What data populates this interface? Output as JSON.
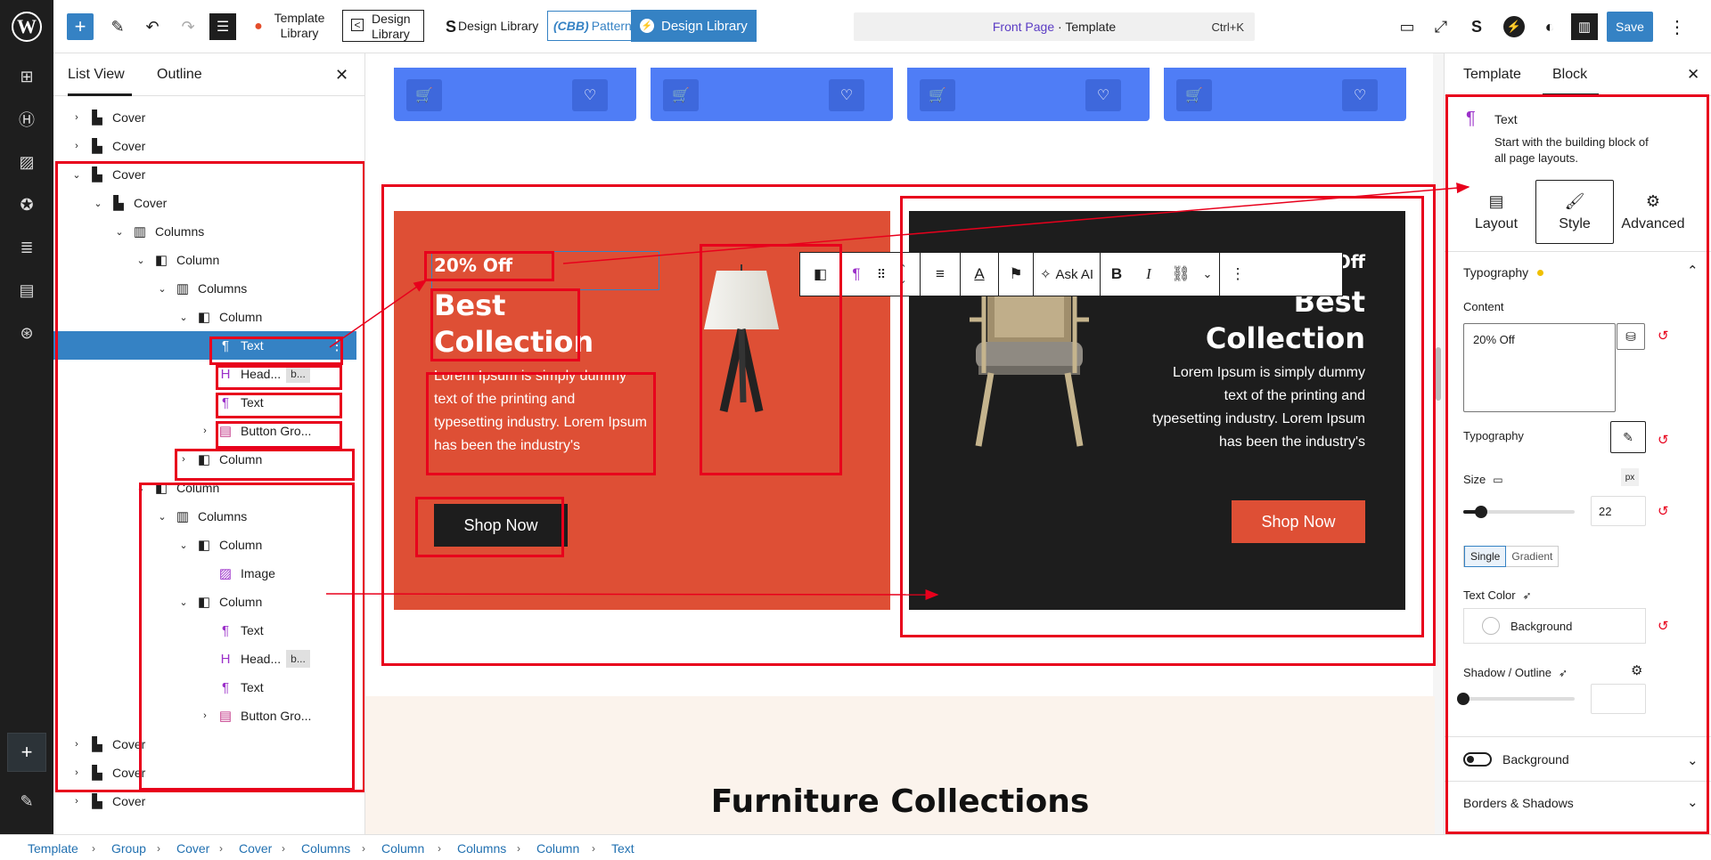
{
  "topbar": {
    "template_library": [
      "Template",
      "Library"
    ],
    "design_library_boxed": [
      "Design",
      "Library"
    ],
    "design_library": "Design Library",
    "cbb_pattern": "Pattern",
    "cbb_badge": "CBB",
    "design_library_btn": "Design Library",
    "command_title": "Front Page",
    "command_sep": " · ",
    "command_sub": "Template",
    "command_shortcut": "Ctrl+K",
    "save": "Save"
  },
  "listview": {
    "tabs": [
      "List View",
      "Outline"
    ],
    "rows": [
      {
        "label": "Cover"
      },
      {
        "label": "Cover"
      },
      {
        "label": "Cover"
      },
      {
        "label": "Cover"
      },
      {
        "label": "Columns"
      },
      {
        "label": "Column"
      },
      {
        "label": "Columns"
      },
      {
        "label": "Column"
      },
      {
        "label": "Text"
      },
      {
        "label": "Head...",
        "badge": "b..."
      },
      {
        "label": "Text"
      },
      {
        "label": "Button Gro..."
      },
      {
        "label": "Column"
      },
      {
        "label": "Column"
      },
      {
        "label": "Columns"
      },
      {
        "label": "Column"
      },
      {
        "label": "Image"
      },
      {
        "label": "Column"
      },
      {
        "label": "Text"
      },
      {
        "label": "Head...",
        "badge": "b..."
      },
      {
        "label": "Text"
      },
      {
        "label": "Button Gro..."
      },
      {
        "label": "Cover"
      },
      {
        "label": "Cover"
      },
      {
        "label": "Cover"
      }
    ]
  },
  "canvas": {
    "promo1": {
      "sub": "20% Off",
      "heading": [
        "Best",
        "Collection"
      ],
      "text": [
        "Lorem Ipsum is simply dummy",
        "text of the printing and",
        "typesetting industry. Lorem Ipsum",
        "has been the industry's"
      ],
      "button": "Shop Now"
    },
    "promo2": {
      "sub": "20% Off",
      "heading": [
        "Best",
        "Collection"
      ],
      "text": [
        "Lorem Ipsum is simply dummy",
        "text of the printing and",
        "typesetting industry. Lorem Ipsum",
        "has been the industry's"
      ],
      "button": "Shop Now"
    },
    "block_toolbar": {
      "ask_ai": "Ask AI"
    },
    "section_title": "Furniture Collections"
  },
  "rpanel": {
    "tabs": [
      "Template",
      "Block"
    ],
    "block_name": "Text",
    "block_desc": [
      "Start with the building block of",
      "all page layouts."
    ],
    "style_tabs": [
      "Layout",
      "Style",
      "Advanced"
    ],
    "typography_section": "Typography",
    "content_label": "Content",
    "content_value": "20% Off",
    "typography_label": "Typography",
    "size_label": "Size",
    "size_unit": "px",
    "size_value": "22",
    "size_level_percent": 16,
    "fill_tabs": [
      "Single",
      "Gradient"
    ],
    "text_color_label": "Text Color",
    "text_color_value": "Background",
    "shadow_label": "Shadow / Outline",
    "shadow_level_percent": 0,
    "background_toggle": "Background",
    "borders_label": "Borders & Shadows"
  },
  "breadcrumb": [
    "Template",
    "Group",
    "Cover",
    "Cover",
    "Columns",
    "Column",
    "Columns",
    "Column",
    "Text"
  ],
  "colors": {
    "accent": "#3582c4",
    "promo_orange": "#de4f35",
    "promo_dark": "#1d1d1d",
    "product_blue": "#4f7df6",
    "annotation_red": "#e8001c"
  },
  "icons": {
    "block_cover": "cover-icon",
    "block_columns": "columns-icon",
    "block_column": "column-icon",
    "block_text": "paragraph-icon",
    "block_heading": "heading-icon",
    "block_button_group": "button-group-icon",
    "block_image": "image-icon"
  }
}
